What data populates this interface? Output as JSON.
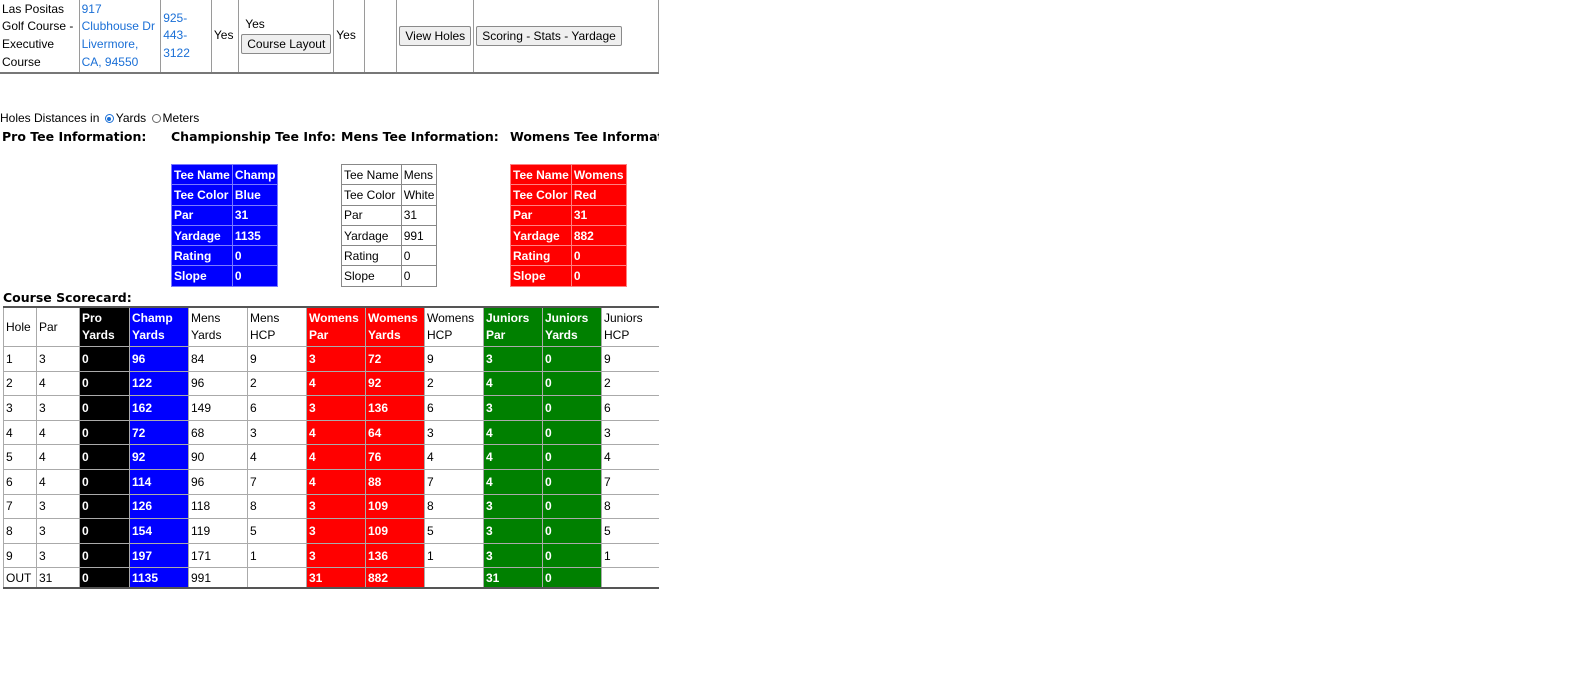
{
  "course_row": {
    "name": "Las Positas Golf Course - Executive Course",
    "address": "917 Clubhouse Dr Livermore, CA, 94550",
    "phone": "925-443-3122",
    "col_yes_1": "Yes",
    "col_yes_2_label": "Yes",
    "course_layout_button": "Course Layout",
    "col_yes_3": "Yes",
    "view_holes_button": "View Holes",
    "scoring_button": "Scoring - Stats - Yardage"
  },
  "units": {
    "label": "Holes Distances in",
    "yards": "Yards",
    "meters": "Meters",
    "selected": "Yards"
  },
  "headings": {
    "pro": "Pro Tee Information:",
    "champ": "Championship Tee Info:",
    "mens": "Mens Tee Information:",
    "womens": "Womens Tee Information:",
    "scorecard": "Course Scorecard:"
  },
  "tee_info": {
    "champ": {
      "Tee Name": "Champ",
      "Tee Color": "Blue",
      "Par": "31",
      "Yardage": "1135",
      "Rating": "0",
      "Slope": "0"
    },
    "mens": {
      "Tee Name": "Mens",
      "Tee Color": "White",
      "Par": "31",
      "Yardage": "991",
      "Rating": "0",
      "Slope": "0"
    },
    "womens": {
      "Tee Name": "Womens",
      "Tee Color": "Red",
      "Par": "31",
      "Yardage": "882",
      "Rating": "0",
      "Slope": "0"
    }
  },
  "tee_labels": [
    "Tee Name",
    "Tee Color",
    "Par",
    "Yardage",
    "Rating",
    "Slope"
  ],
  "scorecard": {
    "headers": [
      "Hole",
      "Par",
      "Pro Yards",
      "Champ Yards",
      "Mens Yards",
      "Mens HCP",
      "Womens Par",
      "Womens Yards",
      "Womens HCP",
      "Juniors Par",
      "Juniors Yards",
      "Juniors HCP"
    ],
    "rows": [
      [
        "1",
        "3",
        "0",
        "96",
        "84",
        "9",
        "3",
        "72",
        "9",
        "3",
        "0",
        "9"
      ],
      [
        "2",
        "4",
        "0",
        "122",
        "96",
        "2",
        "4",
        "92",
        "2",
        "4",
        "0",
        "2"
      ],
      [
        "3",
        "3",
        "0",
        "162",
        "149",
        "6",
        "3",
        "136",
        "6",
        "3",
        "0",
        "6"
      ],
      [
        "4",
        "4",
        "0",
        "72",
        "68",
        "3",
        "4",
        "64",
        "3",
        "4",
        "0",
        "3"
      ],
      [
        "5",
        "4",
        "0",
        "92",
        "90",
        "4",
        "4",
        "76",
        "4",
        "4",
        "0",
        "4"
      ],
      [
        "6",
        "4",
        "0",
        "114",
        "96",
        "7",
        "4",
        "88",
        "7",
        "4",
        "0",
        "7"
      ],
      [
        "7",
        "3",
        "0",
        "126",
        "118",
        "8",
        "3",
        "109",
        "8",
        "3",
        "0",
        "8"
      ],
      [
        "8",
        "3",
        "0",
        "154",
        "119",
        "5",
        "3",
        "109",
        "5",
        "3",
        "0",
        "5"
      ],
      [
        "9",
        "3",
        "0",
        "197",
        "171",
        "1",
        "3",
        "136",
        "1",
        "3",
        "0",
        "1"
      ]
    ],
    "out": [
      "OUT",
      "31",
      "0",
      "1135",
      "991",
      "",
      "31",
      "882",
      "",
      "31",
      "0",
      ""
    ]
  },
  "colors": {
    "pro": "#000000",
    "champ": "#0000ff",
    "womens": "#ff0000",
    "juniors": "#008000",
    "link": "#1a6fd6"
  }
}
